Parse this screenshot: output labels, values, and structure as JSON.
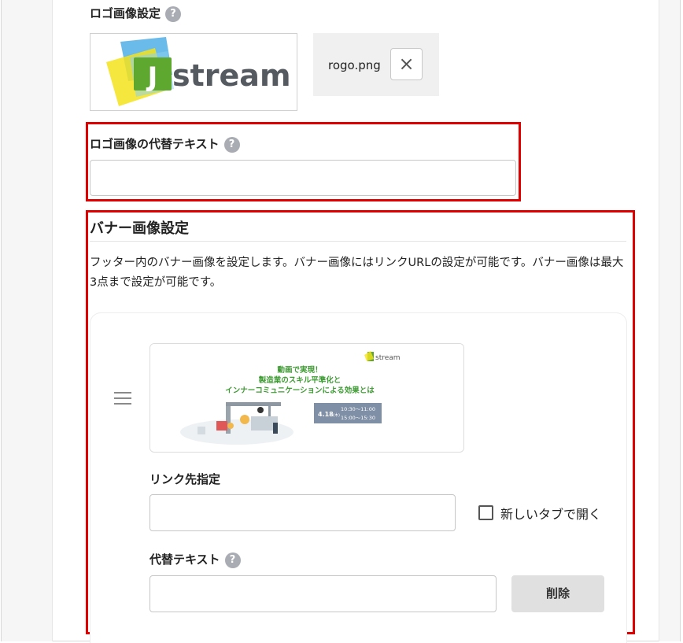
{
  "logo_section": {
    "label": "ロゴ画像設定",
    "help": "?",
    "logo_text": "stream",
    "logo_letter": "J",
    "file_name": "rogo.png",
    "remove_symbol": "×"
  },
  "alt_text_section": {
    "label": "ロゴ画像の代替テキスト",
    "help": "?",
    "value": ""
  },
  "banner_section": {
    "title": "バナー画像設定",
    "description": "フッター内のバナー画像を設定します。バナー画像にはリンクURLの設定が可能です。バナー画像は最大3点まで設定が可能です。",
    "banner_image": {
      "logo": "stream",
      "headline_1": "動画で実現！",
      "headline_2": "製造業のスキル平準化と",
      "headline_3": "インナーコミュニケーションによる効果とは",
      "date": "4.18",
      "day": "(木)",
      "time_1": "10:30～11:00",
      "time_2": "15:00～15:30"
    },
    "link_label": "リンク先指定",
    "link_value": "",
    "new_tab_label": "新しいタブで開く",
    "new_tab_checked": false,
    "alt_label": "代替テキスト",
    "alt_help": "?",
    "alt_value": "",
    "delete_label": "削除"
  },
  "colors": {
    "highlight": "#e10000",
    "brand_green": "#5fa82f",
    "logo_blue": "#5ab4e8",
    "logo_yellow": "#f5e31c"
  }
}
